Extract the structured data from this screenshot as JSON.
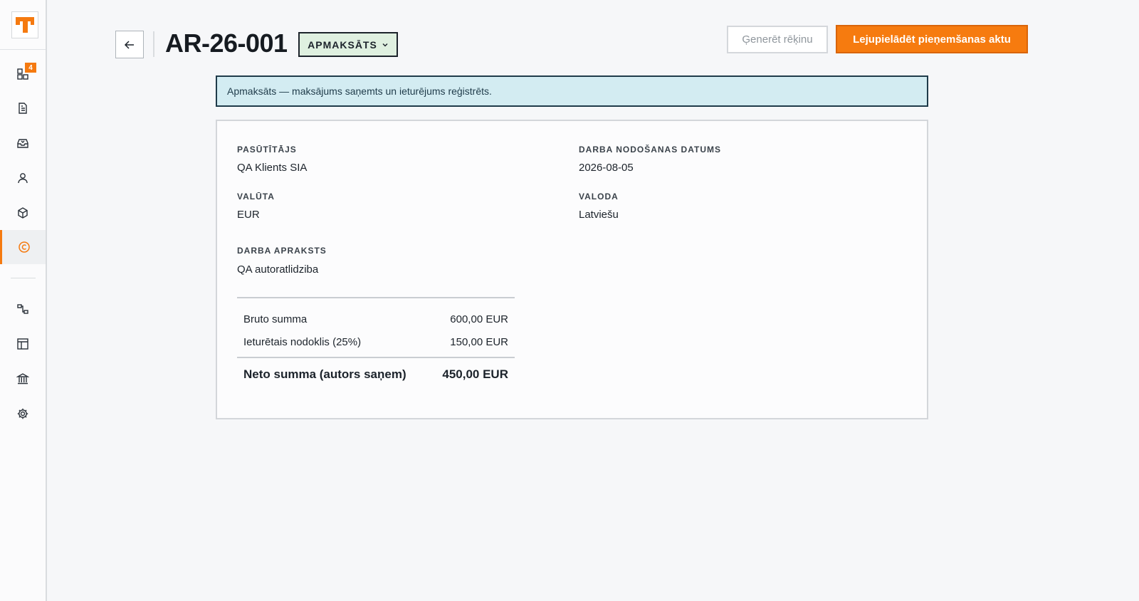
{
  "sidebar": {
    "badge_count": "4",
    "items": [
      {
        "icon": "dashboard-icon"
      },
      {
        "icon": "document-icon"
      },
      {
        "icon": "inbox-icon"
      },
      {
        "icon": "user-icon"
      },
      {
        "icon": "box-icon"
      },
      {
        "icon": "copyright-icon",
        "active": true
      },
      {
        "icon": "relations-icon"
      },
      {
        "icon": "layout-icon"
      },
      {
        "icon": "bank-icon"
      },
      {
        "icon": "settings-icon"
      }
    ]
  },
  "header": {
    "title": "AR-26-001",
    "status": "APMAKSĀTS",
    "generate_invoice_label": "Ģenerēt rēķinu",
    "download_act_label": "Lejupielādēt pieņemšanas aktu"
  },
  "banner": {
    "text": "Apmaksāts — maksājums saņemts un ieturējums reģistrēts."
  },
  "details": {
    "client_label": "PASŪTĪTĀJS",
    "client_value": "QA Klients SIA",
    "date_label": "DARBA NODOŠANAS DATUMS",
    "date_value": "2026-08-05",
    "currency_label": "VALŪTA",
    "currency_value": "EUR",
    "language_label": "VALODA",
    "language_value": "Latviešu",
    "description_label": "DARBA APRAKSTS",
    "description_value": "QA autoratlidziba"
  },
  "summary": {
    "gross_label": "Bruto summa",
    "gross_value": "600,00 EUR",
    "tax_label": "Ieturētais nodoklis (25%)",
    "tax_value": "150,00 EUR",
    "net_label": "Neto summa (autors saņem)",
    "net_value": "450,00 EUR"
  },
  "colors": {
    "accent": "#f67b0f",
    "status_bg": "#dff0e0",
    "banner_bg": "#d3ecf2"
  }
}
